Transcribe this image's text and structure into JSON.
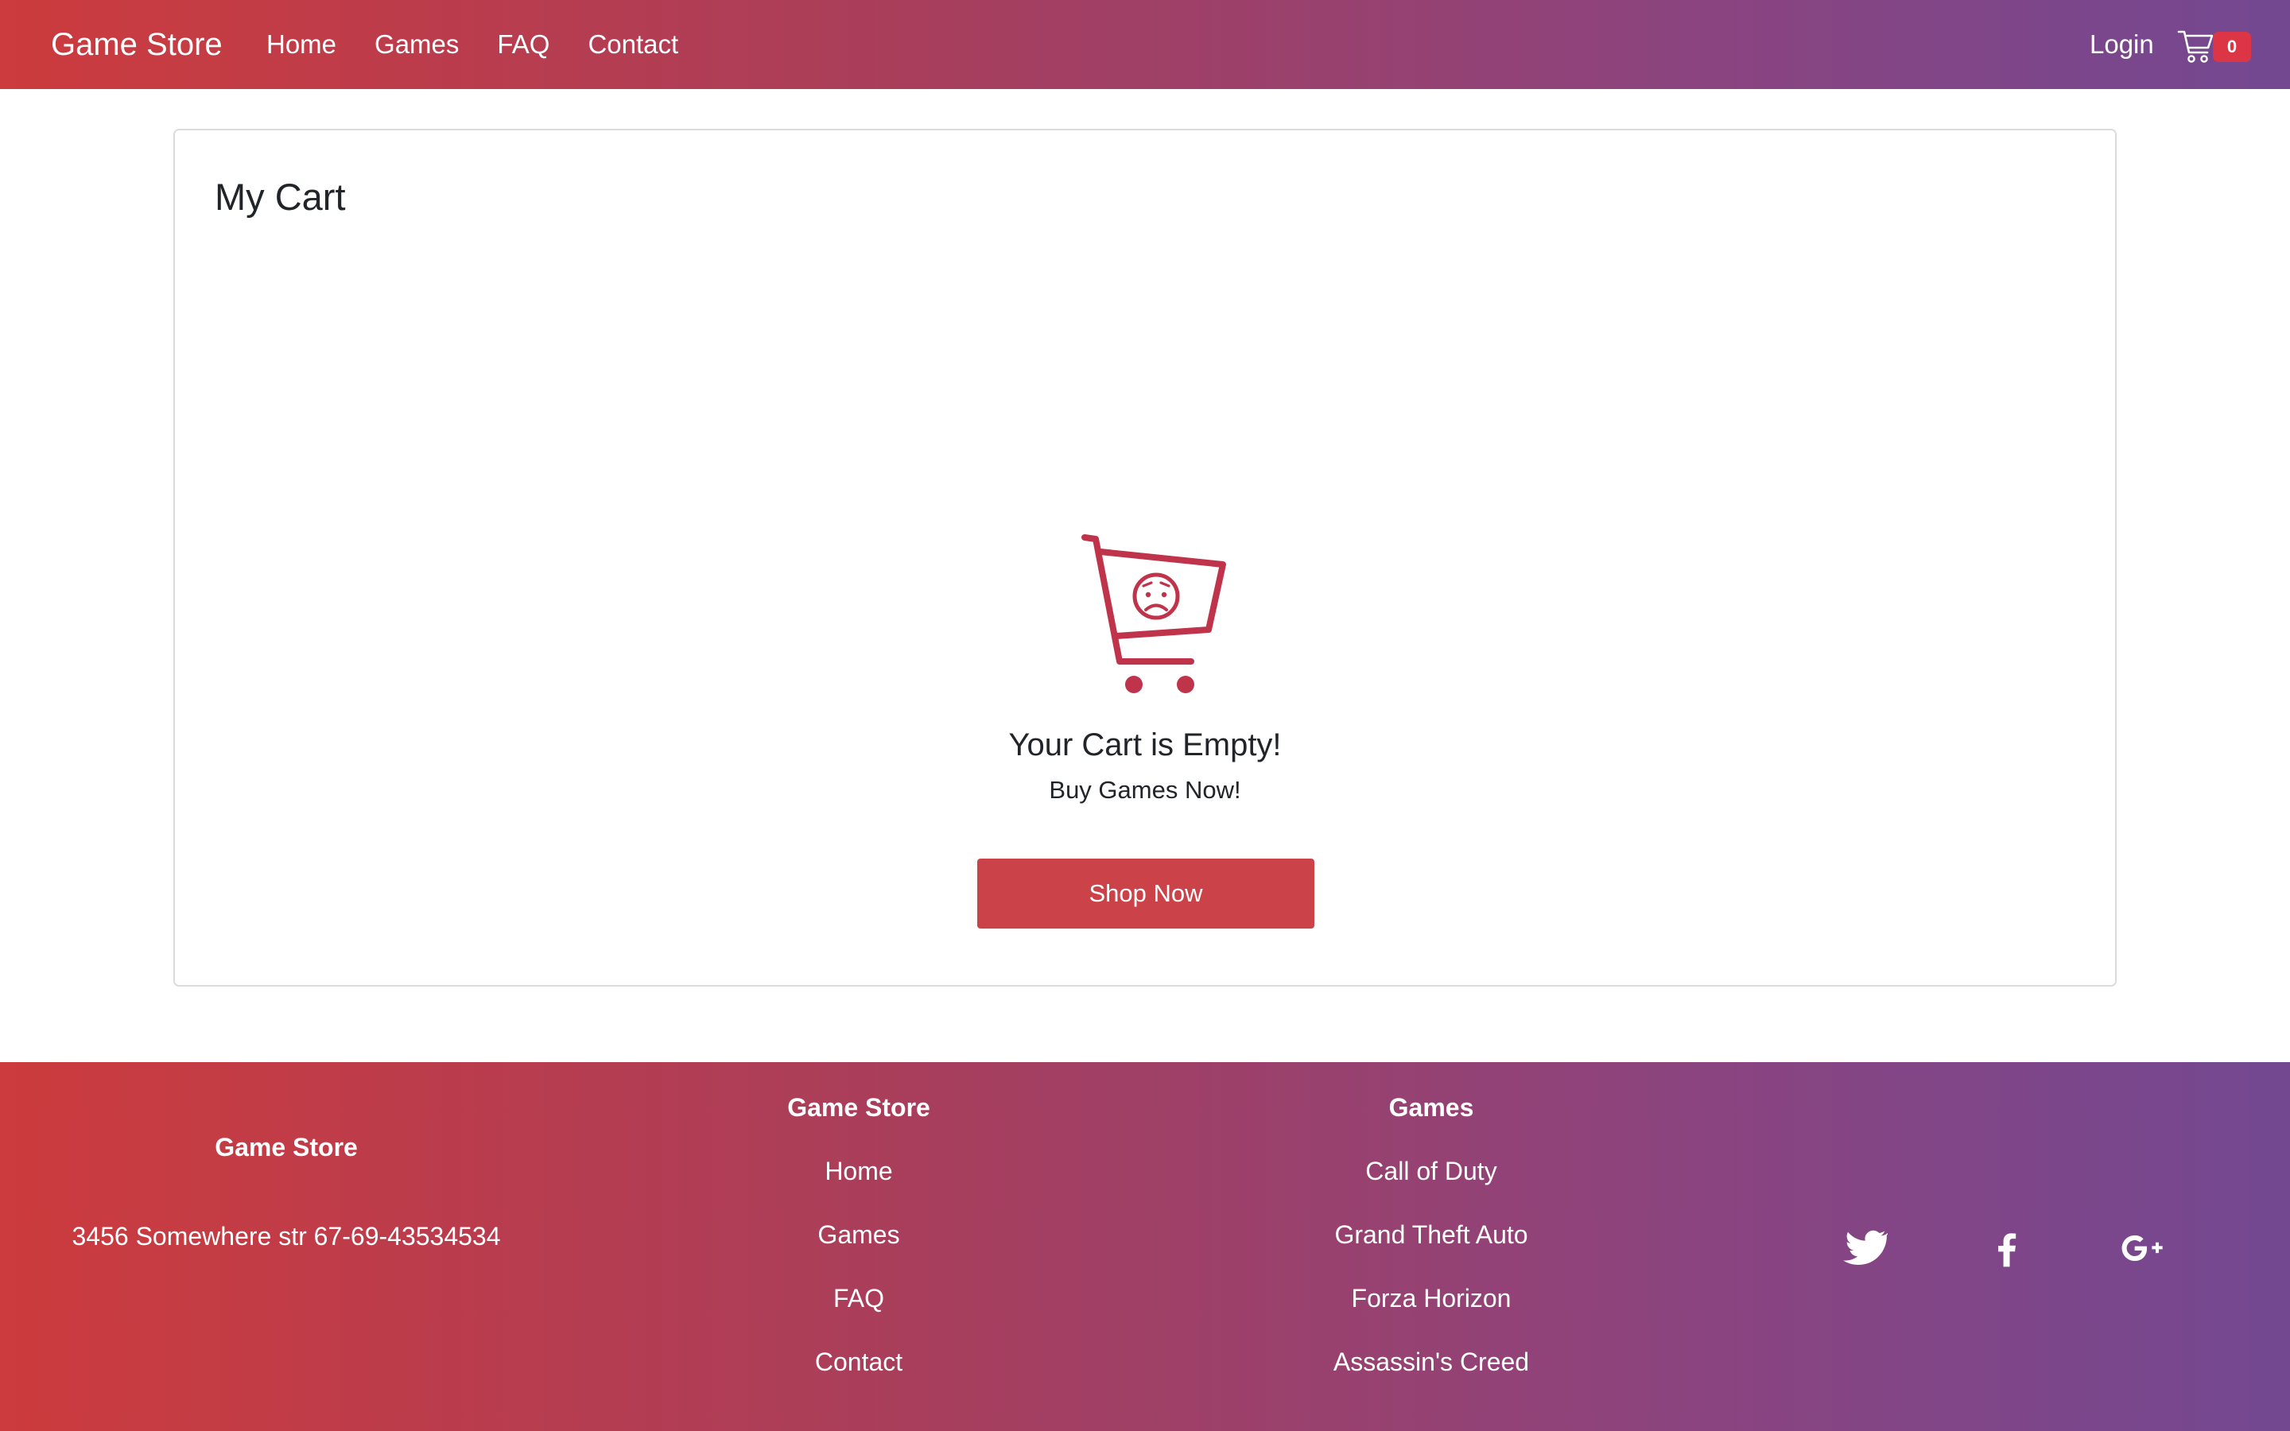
{
  "navbar": {
    "brand": "Game Store",
    "links": [
      "Home",
      "Games",
      "FAQ",
      "Contact"
    ],
    "login": "Login",
    "cart_count": "0"
  },
  "cart": {
    "title": "My Cart",
    "empty_heading": "Your Cart is Empty!",
    "empty_sub": "Buy Games Now!",
    "shop_button": "Shop Now"
  },
  "footer": {
    "brand": "Game Store",
    "address": "3456 Somewhere str 67-69-43534534",
    "col2_heading": "Game Store",
    "col2_links": [
      "Home",
      "Games",
      "FAQ",
      "Contact"
    ],
    "col3_heading": "Games",
    "col3_links": [
      "Call of Duty",
      "Grand Theft Auto",
      "Forza Horizon",
      "Assassin's Creed"
    ],
    "social_icons": [
      "twitter-icon",
      "facebook-icon",
      "google-plus-icon"
    ]
  },
  "colors": {
    "gradient_start": "#cc3b3d",
    "gradient_end": "#734891",
    "accent_red": "#cb4349",
    "icon_red": "#c0344b",
    "badge": "#dc3545"
  }
}
